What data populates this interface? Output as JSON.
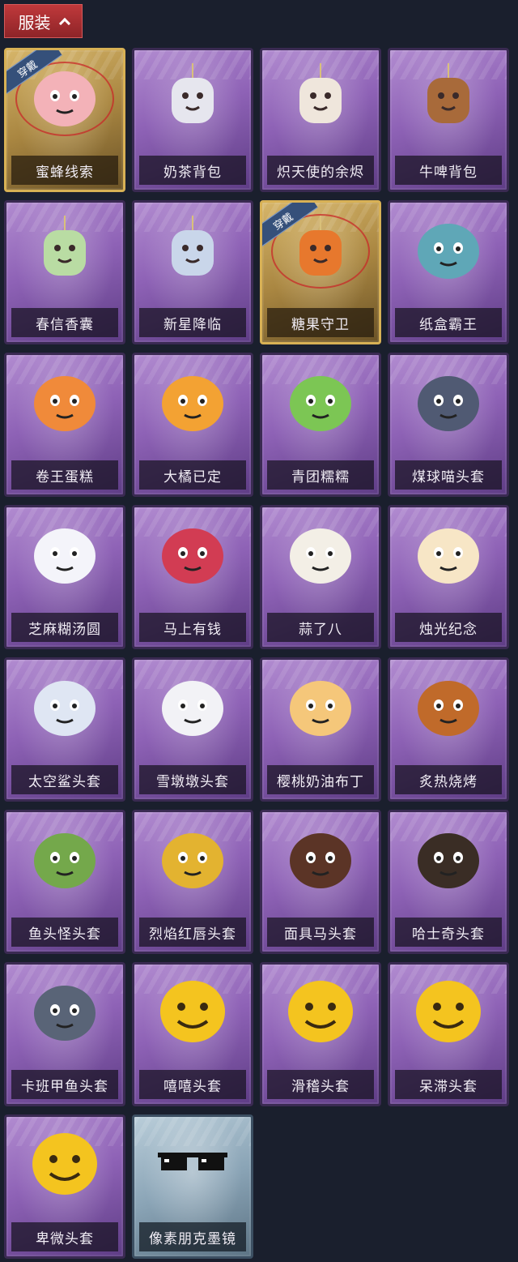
{
  "section": {
    "title": "服装"
  },
  "worn_label": "穿戴",
  "items": [
    {
      "name": "蜜蜂线索",
      "style": "gold",
      "worn": true,
      "icon": "bee-costume-icon",
      "color": "#f3b2b8"
    },
    {
      "name": "奶茶背包",
      "style": "purple",
      "worn": false,
      "icon": "milk-tea-backpack-icon",
      "color": "#e6e6ee"
    },
    {
      "name": "炽天使的余烬",
      "style": "purple",
      "worn": false,
      "icon": "seraph-doll-icon",
      "color": "#efe6dc"
    },
    {
      "name": "牛啤背包",
      "style": "purple",
      "worn": false,
      "icon": "cow-beer-backpack-icon",
      "color": "#a86a3a"
    },
    {
      "name": "春信香囊",
      "style": "purple",
      "worn": false,
      "icon": "sachet-icon",
      "color": "#b9dca3"
    },
    {
      "name": "新星降临",
      "style": "purple",
      "worn": false,
      "icon": "star-doll-icon",
      "color": "#c9d6ea"
    },
    {
      "name": "糖果守卫",
      "style": "gold",
      "worn": true,
      "icon": "pumpkin-charm-icon",
      "color": "#e7782d"
    },
    {
      "name": "纸盒霸王",
      "style": "purple",
      "worn": false,
      "icon": "box-dino-icon",
      "color": "#5fa7b7"
    },
    {
      "name": "卷王蛋糕",
      "style": "purple",
      "worn": false,
      "icon": "roll-cake-icon",
      "color": "#f08a3a"
    },
    {
      "name": "大橘已定",
      "style": "purple",
      "worn": false,
      "icon": "orange-head-icon",
      "color": "#f3a233"
    },
    {
      "name": "青团糯糯",
      "style": "purple",
      "worn": false,
      "icon": "green-dumpling-icon",
      "color": "#7cc654"
    },
    {
      "name": "煤球喵头套",
      "style": "purple",
      "worn": false,
      "icon": "black-cat-head-icon",
      "color": "#505a73"
    },
    {
      "name": "芝麻糊汤圆",
      "style": "purple",
      "worn": false,
      "icon": "rice-ball-icon",
      "color": "#f4f4fa"
    },
    {
      "name": "马上有钱",
      "style": "purple",
      "worn": false,
      "icon": "red-horse-icon",
      "color": "#d23c53"
    },
    {
      "name": "蒜了八",
      "style": "purple",
      "worn": false,
      "icon": "garlic-head-icon",
      "color": "#f3efe6"
    },
    {
      "name": "烛光纪念",
      "style": "purple",
      "worn": false,
      "icon": "candle-head-icon",
      "color": "#f7e6c6"
    },
    {
      "name": "太空鲨头套",
      "style": "purple",
      "worn": false,
      "icon": "shark-head-icon",
      "color": "#dfe6f3"
    },
    {
      "name": "雪墩墩头套",
      "style": "purple",
      "worn": false,
      "icon": "snowman-head-icon",
      "color": "#f2f2f6"
    },
    {
      "name": "樱桃奶油布丁",
      "style": "purple",
      "worn": false,
      "icon": "pudding-head-icon",
      "color": "#f5c77a"
    },
    {
      "name": "炙热烧烤",
      "style": "purple",
      "worn": false,
      "icon": "grilled-meat-icon",
      "color": "#c06a2a"
    },
    {
      "name": "鱼头怪头套",
      "style": "purple",
      "worn": false,
      "icon": "fish-monster-head-icon",
      "color": "#74a84b"
    },
    {
      "name": "烈焰红唇头套",
      "style": "purple",
      "worn": false,
      "icon": "yellow-mask-icon",
      "color": "#e3b330"
    },
    {
      "name": "面具马头套",
      "style": "purple",
      "worn": false,
      "icon": "horse-mask-icon",
      "color": "#5b3426"
    },
    {
      "name": "哈士奇头套",
      "style": "purple",
      "worn": false,
      "icon": "husky-head-icon",
      "color": "#3a2d25"
    },
    {
      "name": "卡班甲鱼头套",
      "style": "purple",
      "worn": false,
      "icon": "fish-head-icon",
      "color": "#596477"
    },
    {
      "name": "嘻嘻头套",
      "style": "purple",
      "worn": false,
      "icon": "grin-emoji-head-icon",
      "color": "#f4c41f"
    },
    {
      "name": "滑稽头套",
      "style": "purple",
      "worn": false,
      "icon": "smirk-emoji-head-icon",
      "color": "#f4c41f"
    },
    {
      "name": "呆滞头套",
      "style": "purple",
      "worn": false,
      "icon": "dazed-emoji-head-icon",
      "color": "#f4c41f"
    },
    {
      "name": "卑微头套",
      "style": "purple",
      "worn": false,
      "icon": "humble-emoji-head-icon",
      "color": "#f4c41f"
    },
    {
      "name": "像素朋克墨镜",
      "style": "blue",
      "worn": false,
      "icon": "pixel-sunglasses-icon",
      "color": "#111111"
    }
  ]
}
